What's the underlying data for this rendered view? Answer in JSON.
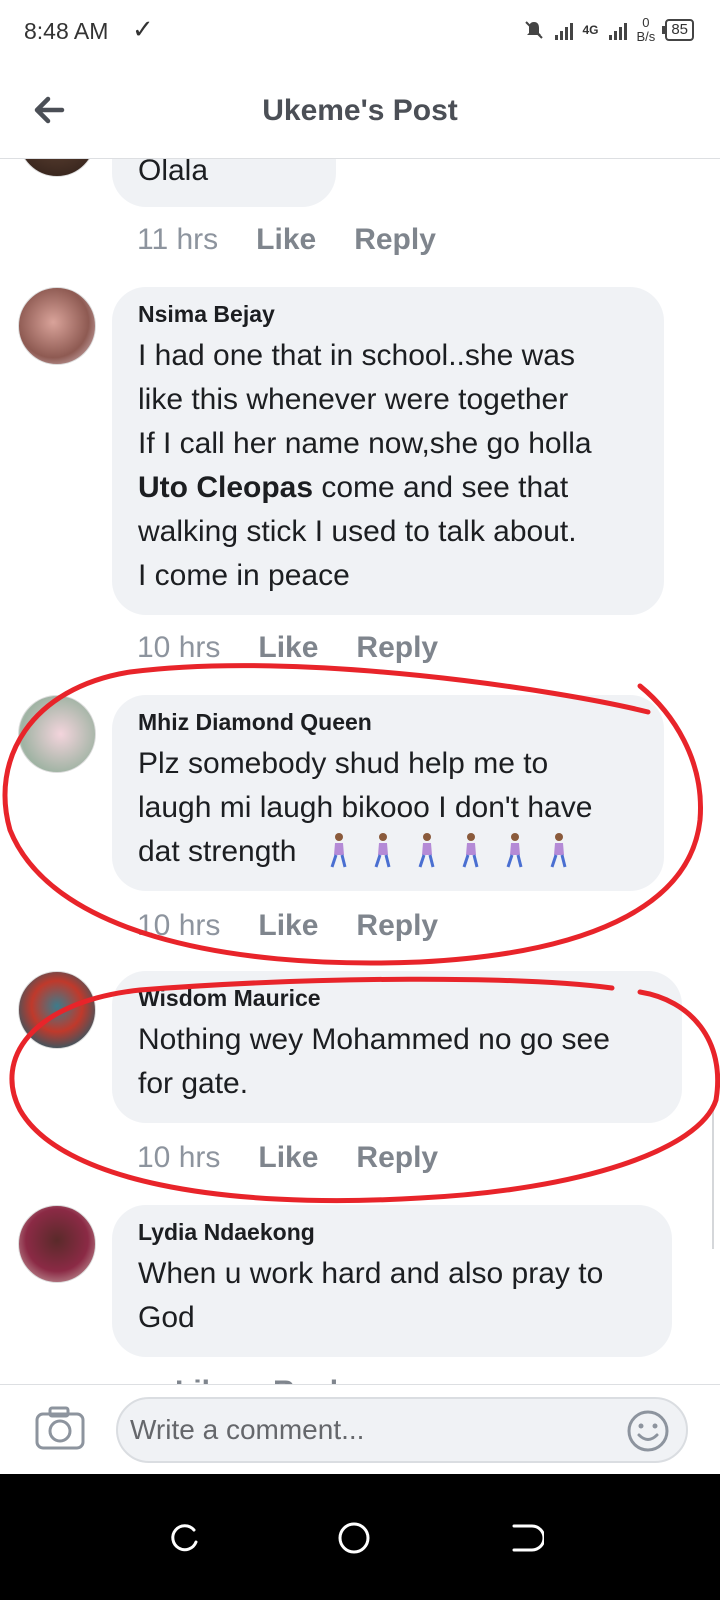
{
  "status": {
    "time": "8:48 AM",
    "network": "4G",
    "speed_value": "0",
    "speed_unit": "B/s",
    "battery": "85"
  },
  "header": {
    "title": "Ukeme's Post"
  },
  "comments": [
    {
      "name": "",
      "text": "Olala",
      "time": "11 hrs"
    },
    {
      "name": "Nsima Bejay",
      "lines": [
        "I had one that in school..she was",
        "like this whenever were together",
        "If I call her name now,she go holla"
      ],
      "mention": "Uto Cleopas",
      "after_mention": " come and see that",
      "lines2": [
        "walking stick I used to talk about.",
        "I come in peace"
      ],
      "time": "10 hrs"
    },
    {
      "name": "Mhiz Diamond Queen",
      "lines": [
        "Plz somebody shud help me to",
        "laugh mi laugh bikooo I don't have",
        "dat strength"
      ],
      "time": "10 hrs"
    },
    {
      "name": "Wisdom Maurice",
      "lines": [
        "Nothing wey Mohammed no go see",
        "for gate."
      ],
      "time": "10 hrs"
    },
    {
      "name": "Lydia Ndaekong",
      "lines": [
        "When u work hard and also pray to",
        "God"
      ],
      "time": ""
    }
  ],
  "actions": {
    "like": "Like",
    "reply": "Reply"
  },
  "composer": {
    "placeholder": "Write a comment..."
  },
  "icons": [
    "back-arrow-icon",
    "camera-icon",
    "smiley-icon",
    "check-icon",
    "mute-bell-icon",
    "signal-icon",
    "battery-icon",
    "recent-apps-icon",
    "home-icon",
    "nav-back-icon"
  ],
  "colors": {
    "annotation": "#e8242a",
    "bubble": "#f0f2f5",
    "meta": "#8d949e"
  }
}
